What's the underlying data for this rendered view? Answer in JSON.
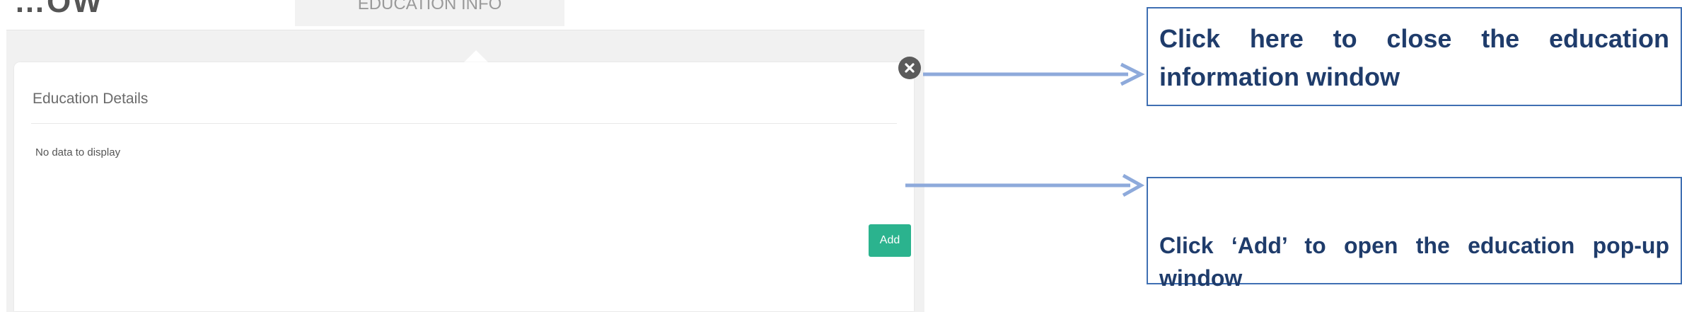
{
  "header_partial": {
    "text": "…OW"
  },
  "tab": {
    "label": "EDUCATION INFO"
  },
  "panel": {
    "title": "Education Details",
    "empty_message": "No data to display",
    "add_label": "Add"
  },
  "callouts": [
    {
      "text": "Click here to close the education information window"
    },
    {
      "text": "Click ‘Add’ to open the education pop-up window"
    }
  ],
  "colors": {
    "accent": "#2bb38e",
    "callout_border": "#3f6fb3",
    "callout_text": "#1f3c6b",
    "arrow": "#8eaadb"
  },
  "icons": {
    "close": "close-circle-icon"
  }
}
